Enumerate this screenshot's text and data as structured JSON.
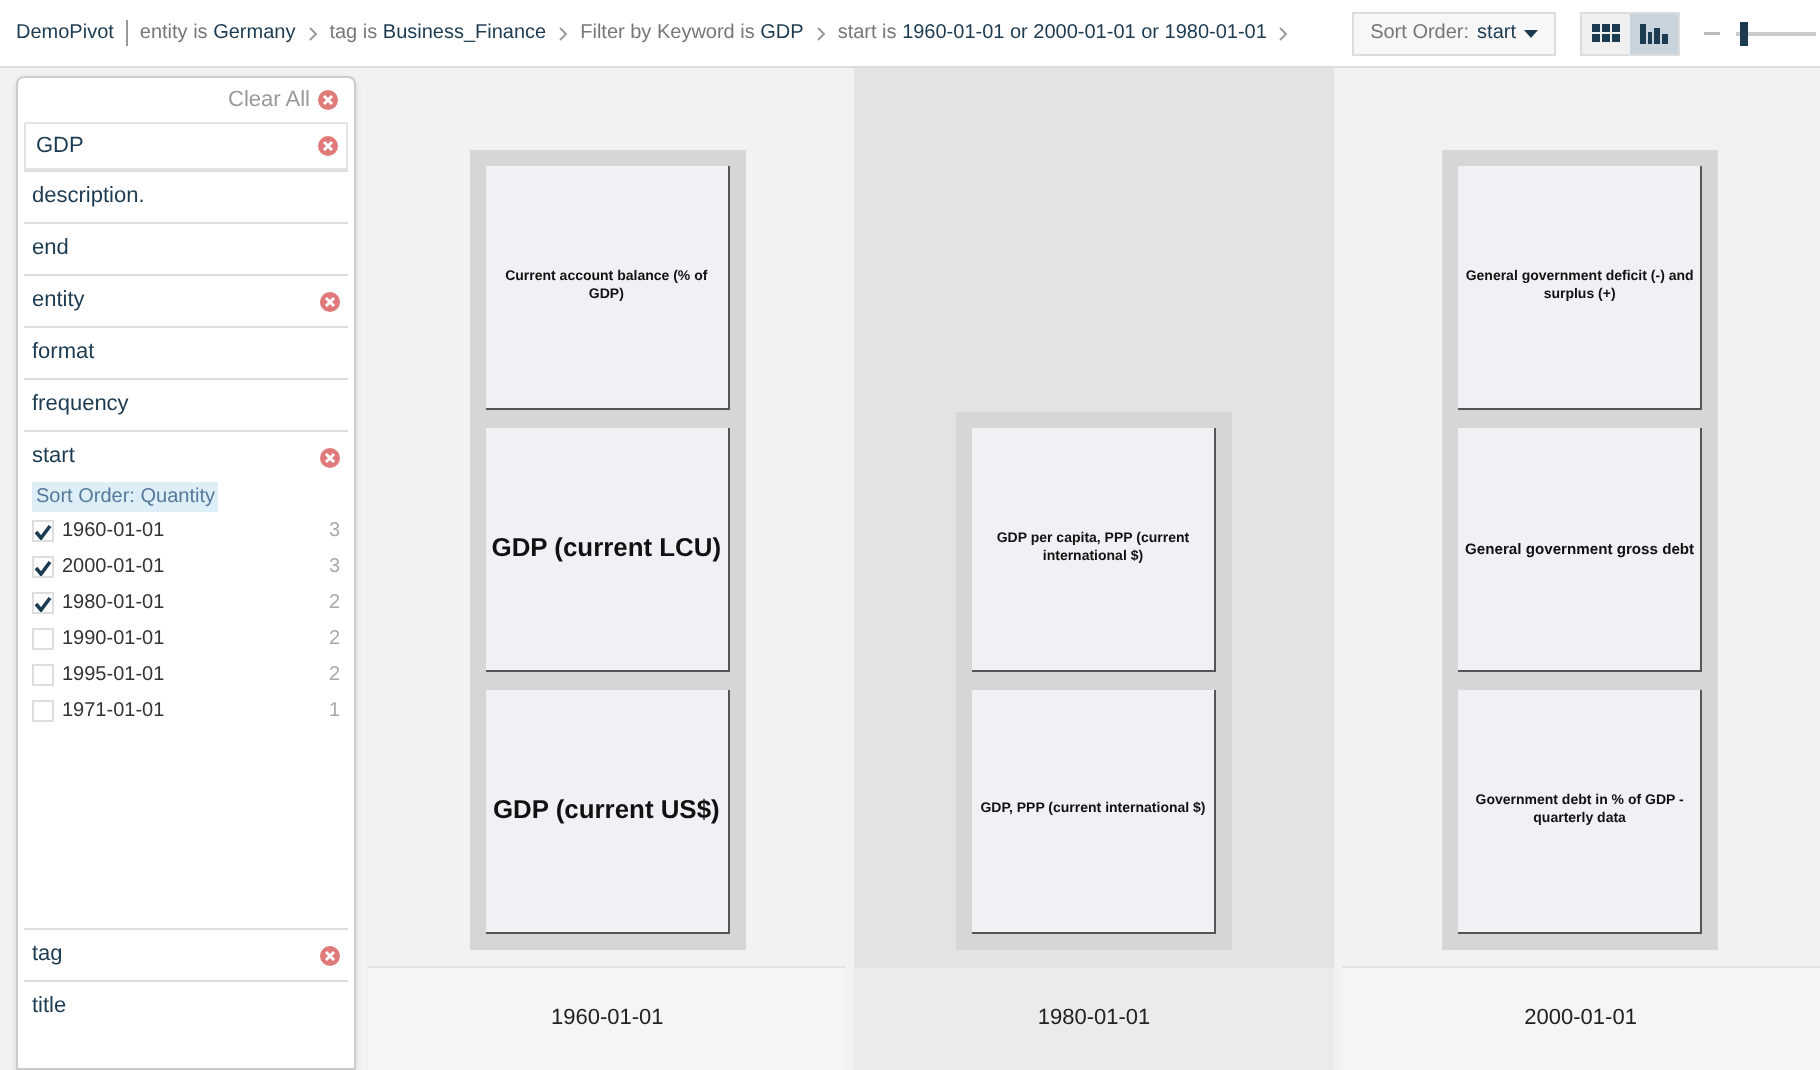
{
  "breadcrumb": {
    "home": "DemoPivot",
    "crumbs": [
      {
        "label": "entity is",
        "value": "Germany"
      },
      {
        "label": "tag is",
        "value": "Business_Finance"
      },
      {
        "label": "Filter by Keyword is",
        "value": "GDP"
      },
      {
        "label": "start is",
        "value": "1960-01-01 or 2000-01-01 or 1980-01-01"
      }
    ]
  },
  "sort_menu": {
    "label": "Sort Order:",
    "value": "start"
  },
  "views": [
    {
      "kind": "grid",
      "selected": false
    },
    {
      "kind": "bars",
      "selected": true
    }
  ],
  "zoom_slider": {
    "level": 0.05
  },
  "filter_panel": {
    "clear_all": "Clear All",
    "search": {
      "value": "GDP"
    },
    "facets": [
      {
        "name": "description.",
        "filtered": false
      },
      {
        "name": "end",
        "filtered": false
      },
      {
        "name": "entity",
        "filtered": true
      },
      {
        "name": "format",
        "filtered": false
      },
      {
        "name": "frequency",
        "filtered": false
      },
      {
        "name": "start",
        "filtered": true,
        "sort_label": "Sort Order: Quantity",
        "options": [
          {
            "label": "1960-01-01",
            "count": "3",
            "checked": true
          },
          {
            "label": "2000-01-01",
            "count": "3",
            "checked": true
          },
          {
            "label": "1980-01-01",
            "count": "2",
            "checked": true
          },
          {
            "label": "1990-01-01",
            "count": "2",
            "checked": false
          },
          {
            "label": "1995-01-01",
            "count": "2",
            "checked": false
          },
          {
            "label": "1971-01-01",
            "count": "1",
            "checked": false
          }
        ]
      },
      {
        "name": "tag",
        "filtered": true
      },
      {
        "name": "title",
        "filtered": false
      }
    ]
  },
  "columns": [
    {
      "label": "1960-01-01",
      "selected": false,
      "tiles": [
        "Current account balance (% of GDP)",
        "GDP (current LCU)",
        "GDP (current US$)"
      ]
    },
    {
      "label": "1980-01-01",
      "selected": true,
      "tiles": [
        "GDP per capita, PPP (current international $)",
        "GDP, PPP (current international $)"
      ]
    },
    {
      "label": "2000-01-01",
      "selected": false,
      "tiles": [
        "General government deficit (-) and surplus (+)",
        "General government gross debt",
        "Government debt in % of GDP - quarterly data"
      ]
    }
  ]
}
